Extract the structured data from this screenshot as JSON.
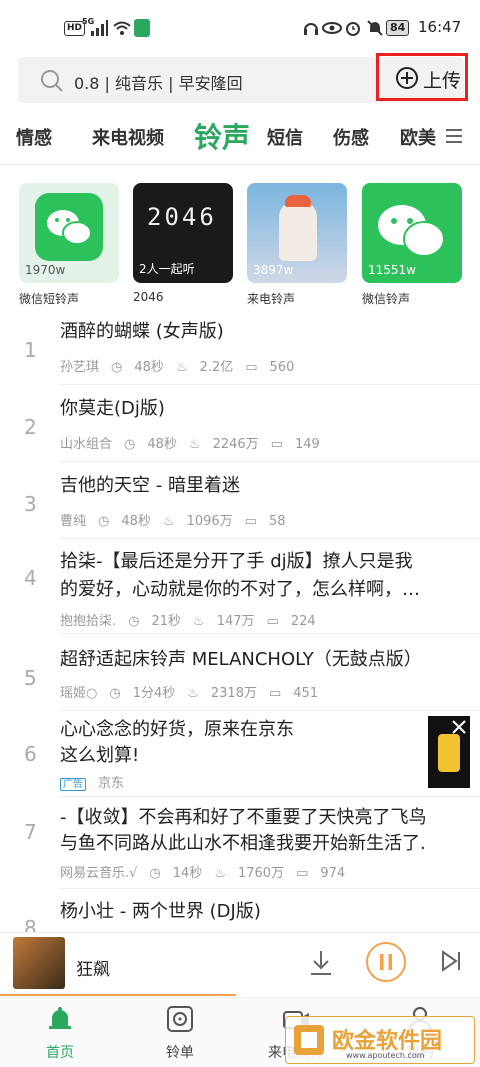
{
  "status_bar": {
    "hd": "HD",
    "net": "5G",
    "battery": "84",
    "time": "16:47"
  },
  "search": {
    "placeholder": "0.8 | 纯音乐 | 早安隆回",
    "upload_label": "上传"
  },
  "tabs": [
    {
      "label": "情感"
    },
    {
      "label": "来电视频"
    },
    {
      "label": "铃声",
      "active": true
    },
    {
      "label": "短信"
    },
    {
      "label": "伤感"
    },
    {
      "label": "欧美"
    }
  ],
  "featured": [
    {
      "caption": "微信短铃声",
      "count": "1970w"
    },
    {
      "caption": "2046",
      "count": "2人一起听",
      "art_text": "2046"
    },
    {
      "caption": "来电铃声",
      "count": "3897w"
    },
    {
      "caption": "微信铃声",
      "count": "11551w"
    }
  ],
  "songs": [
    {
      "num": "1",
      "title": "酒醉的蝴蝶 (女声版)",
      "artist": "孙艺琪",
      "duration": "48秒",
      "plays": "2.2亿",
      "comments": "560"
    },
    {
      "num": "2",
      "title": "你莫走(Dj版)",
      "artist": "山水组合",
      "duration": "48秒",
      "plays": "2246万",
      "comments": "149"
    },
    {
      "num": "3",
      "title": "吉他的天空 - 暗里着迷",
      "artist": "曹纯",
      "duration": "48秒",
      "plays": "1096万",
      "comments": "58"
    },
    {
      "num": "4",
      "title_line1": "拾柒-【最后还是分开了手 dj版】撩人只是我",
      "title_line2": "的爱好，心动就是你的不对了，怎么样啊，…",
      "artist": "抱抱拾柒.",
      "duration": "21秒",
      "plays": "147万",
      "comments": "224"
    },
    {
      "num": "5",
      "title": "超舒适起床铃声 MELANCHOLY（无鼓点版）",
      "artist": "瑶姬○",
      "duration": "1分4秒",
      "plays": "2318万",
      "comments": "451"
    },
    {
      "num": "7",
      "title_line1": "-【收敛】不会再和好了不重要了天快亮了飞鸟",
      "title_line2": "与鱼不同路从此山水不相逢我要开始新生活了.",
      "artist": "网易云音乐.√",
      "duration": "14秒",
      "plays": "1760万",
      "comments": "974"
    },
    {
      "num": "8",
      "title": "杨小壮 - 两个世界 (DJ版)"
    }
  ],
  "ad": {
    "num": "6",
    "line1": "心心念念的好货，原来在京东",
    "line2": "这么划算!",
    "tag": "广告",
    "source": "京东"
  },
  "player": {
    "song": "狂飙"
  },
  "nav": [
    {
      "label": "首页",
      "active": true
    },
    {
      "label": "铃单"
    },
    {
      "label": "来电视频"
    },
    {
      "label": "我的"
    }
  ],
  "watermark": {
    "text": "欧金软件园",
    "url": "www.apoutech.com"
  },
  "colors": {
    "accent": "#2aa860",
    "highlight_box": "#e8231f",
    "progress": "#f5a04a"
  }
}
